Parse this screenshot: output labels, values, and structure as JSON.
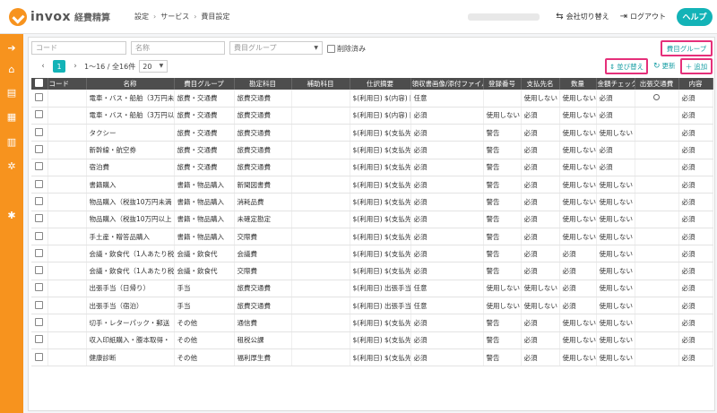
{
  "header": {
    "logo_text": "invox",
    "logo_sub": "経費精算",
    "breadcrumb": [
      "設定",
      "サービス",
      "費目設定"
    ],
    "switch_company": "会社切り替え",
    "logout": "ログアウト",
    "help": "ヘルプ"
  },
  "sidebar": {
    "icons": [
      "arrow-right-circle-icon",
      "home-icon",
      "document-icon",
      "document-export-icon",
      "chart-icon",
      "settings-gear-icon",
      "tools-icon"
    ]
  },
  "filters": {
    "code_placeholder": "コード",
    "name_placeholder": "名称",
    "group_placeholder": "費目グループ",
    "deleted_label": "削除済み"
  },
  "pagination": {
    "current_page": "1",
    "range_text": "1〜16 / 全16件",
    "per_page": "20"
  },
  "actions": {
    "group_button": "費目グループ",
    "sort_button": "並び替え",
    "refresh_button": "更新",
    "add_button": "追加"
  },
  "columns": [
    "",
    "コード",
    "名称",
    "費目グループ",
    "勘定科目",
    "補助科目",
    "仕訳摘要",
    "領収書画像/添付ファイル",
    "登録番号",
    "支払先名",
    "数量",
    "金額チェック",
    "出張交通費",
    "内容"
  ],
  "rows": [
    {
      "code": "",
      "name": "電車・バス・船舶（3万円未",
      "group": "旅費・交通費",
      "account": "旅費交通費",
      "sub": "",
      "memo": "$(利用日) $(内容) [",
      "receipt": "任意",
      "reg": "",
      "payee": "使用しない",
      "qty": "使用しない",
      "amount": "必須",
      "travel": "○",
      "content": "必須"
    },
    {
      "code": "",
      "name": "電車・バス・船舶（3万円以",
      "group": "旅費・交通費",
      "account": "旅費交通費",
      "sub": "",
      "memo": "$(利用日) $(内容) [",
      "receipt": "必須",
      "reg": "使用しない",
      "payee": "必須",
      "qty": "使用しない",
      "amount": "必須",
      "travel": "",
      "content": "必須"
    },
    {
      "code": "",
      "name": "タクシー",
      "group": "旅費・交通費",
      "account": "旅費交通費",
      "sub": "",
      "memo": "$(利用日) $(支払先",
      "receipt": "必須",
      "reg": "警告",
      "payee": "必須",
      "qty": "使用しない",
      "amount": "使用しない",
      "travel": "",
      "content": "必須"
    },
    {
      "code": "",
      "name": "新幹線・航空券",
      "group": "旅費・交通費",
      "account": "旅費交通費",
      "sub": "",
      "memo": "$(利用日) $(支払先",
      "receipt": "必須",
      "reg": "警告",
      "payee": "必須",
      "qty": "使用しない",
      "amount": "必須",
      "travel": "",
      "content": "必須"
    },
    {
      "code": "",
      "name": "宿泊費",
      "group": "旅費・交通費",
      "account": "旅費交通費",
      "sub": "",
      "memo": "$(利用日) $(支払先",
      "receipt": "必須",
      "reg": "警告",
      "payee": "必須",
      "qty": "使用しない",
      "amount": "必須",
      "travel": "",
      "content": "必須"
    },
    {
      "code": "",
      "name": "書籍購入",
      "group": "書籍・物品購入",
      "account": "新聞図書費",
      "sub": "",
      "memo": "$(利用日) $(支払先",
      "receipt": "必須",
      "reg": "警告",
      "payee": "必須",
      "qty": "使用しない",
      "amount": "使用しない",
      "travel": "",
      "content": "必須"
    },
    {
      "code": "",
      "name": "物品購入（税抜10万円未満",
      "group": "書籍・物品購入",
      "account": "消耗品費",
      "sub": "",
      "memo": "$(利用日) $(支払先",
      "receipt": "必須",
      "reg": "警告",
      "payee": "必須",
      "qty": "使用しない",
      "amount": "使用しない",
      "travel": "",
      "content": "必須"
    },
    {
      "code": "",
      "name": "物品購入（税抜10万円以上",
      "group": "書籍・物品購入",
      "account": "未確定勘定",
      "sub": "",
      "memo": "$(利用日) $(支払先",
      "receipt": "必須",
      "reg": "警告",
      "payee": "必須",
      "qty": "使用しない",
      "amount": "使用しない",
      "travel": "",
      "content": "必須"
    },
    {
      "code": "",
      "name": "手土産・贈答品購入",
      "group": "書籍・物品購入",
      "account": "交際費",
      "sub": "",
      "memo": "$(利用日) $(支払先",
      "receipt": "必須",
      "reg": "警告",
      "payee": "必須",
      "qty": "使用しない",
      "amount": "使用しない",
      "travel": "",
      "content": "必須"
    },
    {
      "code": "",
      "name": "会議・飲食代（1人あたり税",
      "group": "会議・飲食代",
      "account": "会議費",
      "sub": "",
      "memo": "$(利用日) $(支払先",
      "receipt": "必須",
      "reg": "警告",
      "payee": "必須",
      "qty": "必須",
      "amount": "使用しない",
      "travel": "",
      "content": "必須"
    },
    {
      "code": "",
      "name": "会議・飲食代（1人あたり税",
      "group": "会議・飲食代",
      "account": "交際費",
      "sub": "",
      "memo": "$(利用日) $(支払先",
      "receipt": "必須",
      "reg": "警告",
      "payee": "必須",
      "qty": "必須",
      "amount": "使用しない",
      "travel": "",
      "content": "必須"
    },
    {
      "code": "",
      "name": "出張手当（日帰り）",
      "group": "手当",
      "account": "旅費交通費",
      "sub": "",
      "memo": "$(利用日) 出張手当",
      "receipt": "任意",
      "reg": "使用しない",
      "payee": "使用しない",
      "qty": "必須",
      "amount": "使用しない",
      "travel": "",
      "content": "必須"
    },
    {
      "code": "",
      "name": "出張手当（宿泊）",
      "group": "手当",
      "account": "旅費交通費",
      "sub": "",
      "memo": "$(利用日) 出張手当",
      "receipt": "任意",
      "reg": "使用しない",
      "payee": "使用しない",
      "qty": "必須",
      "amount": "使用しない",
      "travel": "",
      "content": "必須"
    },
    {
      "code": "",
      "name": "切手・レターパック・郵送",
      "group": "その他",
      "account": "通信費",
      "sub": "",
      "memo": "$(利用日) $(支払先",
      "receipt": "必須",
      "reg": "警告",
      "payee": "必須",
      "qty": "使用しない",
      "amount": "使用しない",
      "travel": "",
      "content": "必須"
    },
    {
      "code": "",
      "name": "収入印紙購入・謄本取得・",
      "group": "その他",
      "account": "租税公課",
      "sub": "",
      "memo": "$(利用日) $(支払先",
      "receipt": "必須",
      "reg": "警告",
      "payee": "必須",
      "qty": "使用しない",
      "amount": "使用しない",
      "travel": "",
      "content": "必須"
    },
    {
      "code": "",
      "name": "健康診断",
      "group": "その他",
      "account": "福利厚生費",
      "sub": "",
      "memo": "$(利用日) $(支払先",
      "receipt": "必須",
      "reg": "警告",
      "payee": "必須",
      "qty": "使用しない",
      "amount": "使用しない",
      "travel": "",
      "content": "必須"
    }
  ]
}
